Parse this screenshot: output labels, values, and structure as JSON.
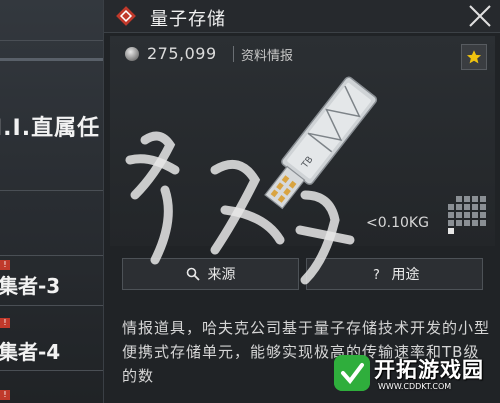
{
  "left_list": {
    "task_title": "I.I.直属任",
    "rows": [
      {
        "label": "集者-3"
      },
      {
        "label": "集者-4"
      }
    ]
  },
  "dialog": {
    "title": "量子存储",
    "close_icon": "close-icon",
    "price": "275,099",
    "category": "资料情报",
    "favorite_icon": "star-icon",
    "weight": "<0.10KG",
    "buttons": {
      "source_label": "来源",
      "usage_label": "用途"
    },
    "description": "情报道具，哈夫克公司基于量子存储技术开发的小型便携式存储单元，能够实现极高的传输速率和TB级的数"
  },
  "watermarks": {
    "brand_name": "开拓游戏园",
    "brand_url": "WWW.CDDKT.COM"
  },
  "colors": {
    "accent_red": "#c0392b",
    "star_gold": "#f1c40f",
    "panel_bg": "#202326",
    "brand_green": "#2fae3c"
  }
}
